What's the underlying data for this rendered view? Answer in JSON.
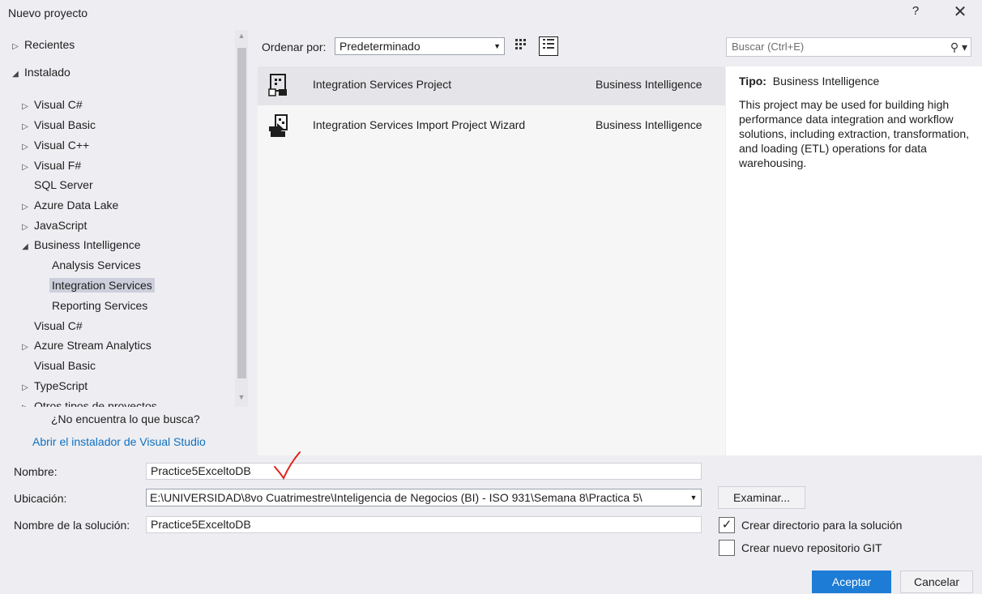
{
  "window": {
    "title": "Nuevo proyecto",
    "help": "?",
    "close": "✕"
  },
  "tree": {
    "items": [
      {
        "label": "Recientes",
        "arrow": "▷",
        "selected": false
      },
      {
        "label": "Instalado",
        "arrow": "◢",
        "selected": false
      },
      {
        "label": "Visual C#",
        "arrow": "▷",
        "selected": false
      },
      {
        "label": "Visual Basic",
        "arrow": "▷",
        "selected": false
      },
      {
        "label": "Visual C++",
        "arrow": "▷",
        "selected": false
      },
      {
        "label": "Visual F#",
        "arrow": "▷",
        "selected": false
      },
      {
        "label": "SQL Server",
        "arrow": "",
        "selected": false
      },
      {
        "label": "Azure Data Lake",
        "arrow": "▷",
        "selected": false
      },
      {
        "label": "JavaScript",
        "arrow": "▷",
        "selected": false
      },
      {
        "label": "Business Intelligence",
        "arrow": "◢",
        "selected": false
      },
      {
        "label": "Analysis Services",
        "arrow": "",
        "selected": false
      },
      {
        "label": "Integration Services",
        "arrow": "",
        "selected": true
      },
      {
        "label": "Reporting Services",
        "arrow": "",
        "selected": false
      },
      {
        "label": "Visual C#",
        "arrow": "",
        "selected": false
      },
      {
        "label": "Azure Stream Analytics",
        "arrow": "▷",
        "selected": false
      },
      {
        "label": "Visual Basic",
        "arrow": "",
        "selected": false
      },
      {
        "label": "TypeScript",
        "arrow": "▷",
        "selected": false
      },
      {
        "label": "Otros tipos de proyectos",
        "arrow": "▷",
        "selected": false
      }
    ],
    "not_found": "¿No encuentra lo que busca?",
    "installer_link": "Abrir el instalador de Visual Studio"
  },
  "toolbar": {
    "sort_label": "Ordenar por:",
    "sort_value": "Predeterminado"
  },
  "projects": [
    {
      "name": "Integration Services Project",
      "category": "Business Intelligence",
      "selected": true
    },
    {
      "name": "Integration Services Import Project Wizard",
      "category": "Business Intelligence",
      "selected": false
    }
  ],
  "search": {
    "placeholder": "Buscar (Ctrl+E)"
  },
  "details": {
    "tipo_label": "Tipo:",
    "tipo_value": "Business Intelligence",
    "description": "This project may be used for building high performance data integration and workflow solutions, including extraction, transformation, and loading (ETL) operations for data warehousing."
  },
  "form": {
    "name_label": "Nombre:",
    "name_value": "Practice5ExceltoDB",
    "location_label": "Ubicación:",
    "location_value": "E:\\UNIVERSIDAD\\8vo Cuatrimestre\\Inteligencia de Negocios (BI) - ISO 931\\Semana 8\\Practica 5\\",
    "solution_label": "Nombre de la solución:",
    "solution_value": "Practice5ExceltoDB",
    "browse_label": "Examinar...",
    "create_dir_label": "Crear directorio para la solución",
    "create_dir_checked": true,
    "create_git_label": "Crear nuevo repositorio GIT",
    "create_git_checked": false,
    "accept_label": "Aceptar",
    "cancel_label": "Cancelar"
  },
  "colors": {
    "accent": "#1c7cd6",
    "link": "#0e70c0",
    "selection": "#cccedb",
    "annotation": "#e0201c"
  }
}
